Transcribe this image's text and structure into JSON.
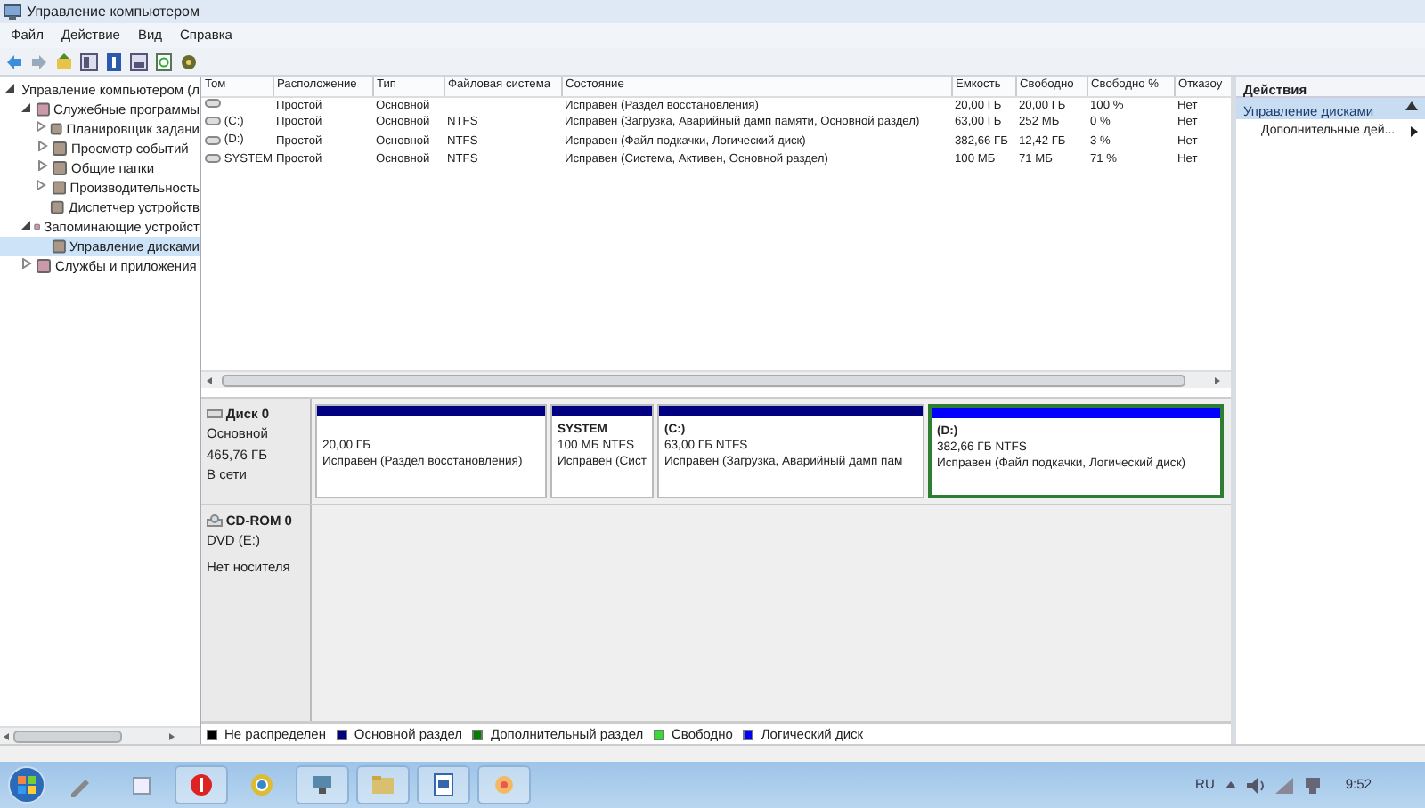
{
  "window": {
    "title": "Управление компьютером"
  },
  "menu": [
    "Файл",
    "Действие",
    "Вид",
    "Справка"
  ],
  "tree": [
    {
      "label": "Управление компьютером (л",
      "expanded": true,
      "selected": false,
      "children": [
        {
          "label": "Служебные программы",
          "expanded": true,
          "selected": false,
          "children": [
            {
              "label": "Планировщик задани",
              "expanded": false,
              "selected": false
            },
            {
              "label": "Просмотр событий",
              "expanded": false,
              "selected": false
            },
            {
              "label": "Общие папки",
              "expanded": false,
              "selected": false
            },
            {
              "label": "Производительность",
              "expanded": false,
              "selected": false
            },
            {
              "label": "Диспетчер устройств",
              "selected": false
            }
          ]
        },
        {
          "label": "Запоминающие устройст",
          "expanded": true,
          "selected": false,
          "children": [
            {
              "label": "Управление дисками",
              "selected": true
            }
          ]
        },
        {
          "label": "Службы и приложения",
          "expanded": false,
          "selected": false
        }
      ]
    }
  ],
  "table": {
    "columns": [
      "Том",
      "Расположение",
      "Тип",
      "Файловая система",
      "Состояние",
      "Емкость",
      "Свободно",
      "Свободно %",
      "Отказоу"
    ],
    "rows": [
      [
        "",
        "Простой",
        "Основной",
        "",
        "Исправен (Раздел восстановления)",
        "20,00 ГБ",
        "20,00 ГБ",
        "100 %",
        "Нет"
      ],
      [
        "(C:)",
        "Простой",
        "Основной",
        "NTFS",
        "Исправен (Загрузка, Аварийный дамп памяти, Основной раздел)",
        "63,00 ГБ",
        "252 МБ",
        "0 %",
        "Нет"
      ],
      [
        "(D:)",
        "Простой",
        "Основной",
        "NTFS",
        "Исправен (Файл подкачки, Логический диск)",
        "382,66 ГБ",
        "12,42 ГБ",
        "3 %",
        "Нет"
      ],
      [
        "SYSTEM",
        "Простой",
        "Основной",
        "NTFS",
        "Исправен (Система, Активен, Основной раздел)",
        "100 МБ",
        "71 МБ",
        "71 %",
        "Нет"
      ]
    ]
  },
  "disks": [
    {
      "kind": "disk",
      "name": "Диск 0",
      "type": "Основной",
      "size": "465,76 ГБ",
      "status": "В сети",
      "partitions": [
        {
          "kind": "primary",
          "size": "20,00 ГБ",
          "status": "Исправен (Раздел восстановления)",
          "selected": false
        },
        {
          "kind": "primary",
          "name": "SYSTEM",
          "size": "100 МБ NTFS",
          "status": "Исправен (Сист",
          "selected": false
        },
        {
          "kind": "primary",
          "name": "(C:)",
          "size": "63,00 ГБ NTFS",
          "status": "Исправен (Загрузка, Аварийный дамп пам",
          "selected": false
        },
        {
          "kind": "logical",
          "name": "(D:)",
          "size": "382,66 ГБ NTFS",
          "status": "Исправен (Файл подкачки, Логический диск)",
          "selected": true
        }
      ]
    },
    {
      "kind": "cdrom",
      "name": "CD-ROM 0",
      "type": "DVD (E:)",
      "status": "Нет носителя"
    }
  ],
  "legend": [
    {
      "label": "Не распределен",
      "color": "#000000"
    },
    {
      "label": "Основной раздел",
      "color": "#000080"
    },
    {
      "label": "Дополнительный раздел",
      "color": "#008000"
    },
    {
      "label": "Свободно",
      "color": "#33dd33"
    },
    {
      "label": "Логический диск",
      "color": "#0000ff"
    }
  ],
  "actions": {
    "title": "Действия",
    "section": {
      "label": "Управление дисками",
      "expanded": true
    },
    "items": [
      "Дополнительные дей..."
    ]
  },
  "taskbar": {
    "language": "RU",
    "time": "9:52"
  }
}
